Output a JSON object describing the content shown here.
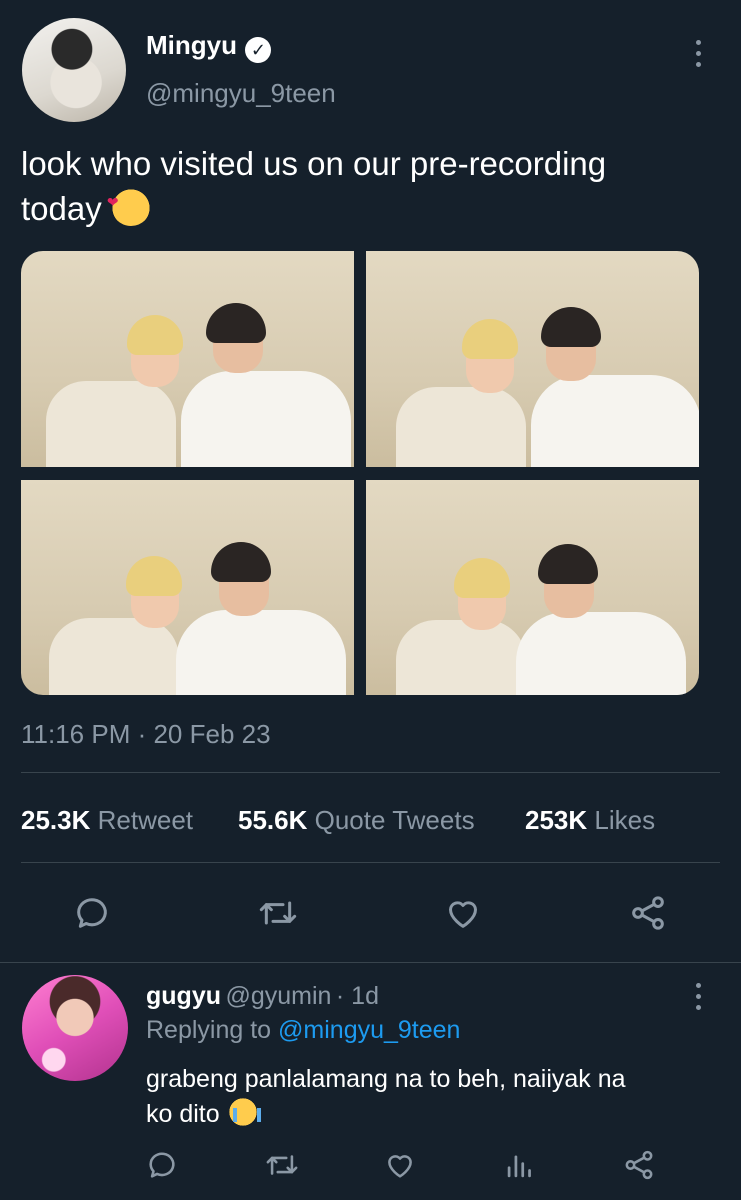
{
  "tweet": {
    "author_name": "Mingyu",
    "author_handle": "@mingyu_9teen",
    "verified": true,
    "text_line1": "look who visited us on our pre-recording",
    "text_line2": "today",
    "emoji": "smiling-face-with-hearts",
    "timestamp": "11:16 PM · 20 Feb 23",
    "photos_count": 4,
    "stats": {
      "retweets_count": "25.3K",
      "retweets_label": "Retweet",
      "quotes_count": "55.6K",
      "quotes_label": "Quote Tweets",
      "likes_count": "253K",
      "likes_label": "Likes"
    },
    "actions": [
      "reply-icon",
      "retweet-icon",
      "like-icon",
      "share-icon"
    ]
  },
  "reply": {
    "author_name": "gugyu",
    "author_handle": "@gyumin",
    "age": "· 1d",
    "replying_prefix": "Replying to",
    "replying_handle": "@mingyu_9teen",
    "text_line1": "grabeng panlalamang na to beh, naiiyak na",
    "text_line2": "ko dito",
    "emoji": "loudly-crying-face",
    "actions": [
      "reply-icon",
      "retweet-icon",
      "like-icon",
      "analytics-icon",
      "share-icon"
    ]
  },
  "colors": {
    "background": "#15202b",
    "text_primary": "#ffffff",
    "text_secondary": "#8b98a5",
    "link": "#1d9bf0",
    "divider": "#38444d"
  }
}
